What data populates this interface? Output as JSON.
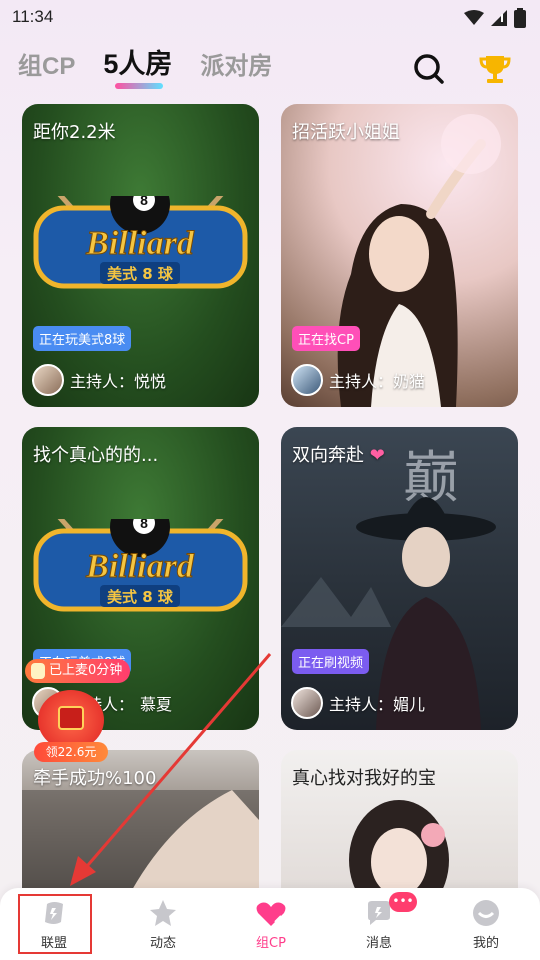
{
  "status": {
    "time": "11:34"
  },
  "tabs": [
    {
      "label": "组CP"
    },
    {
      "label": "5人房"
    },
    {
      "label": "派对房"
    }
  ],
  "cards": [
    {
      "title": "距你2.2米",
      "tag": "正在玩美式8球",
      "host": "主持人：悦悦",
      "logo_text": "Billiard",
      "logo_sub": "美式 8 球"
    },
    {
      "title": "招活跃小姐姐",
      "tag": "正在找CP",
      "host": "主持人：奶猫"
    },
    {
      "title": "找个真心的的...",
      "tag": "正在玩美式8球",
      "host": "主持人：",
      "host_name": "慕夏",
      "logo_text": "Billiard",
      "logo_sub": "美式 8 球"
    },
    {
      "title": "双向奔赴",
      "tag": "正在刷视频",
      "host": "主持人：媚儿",
      "overlay_text": "巅"
    },
    {
      "title": "牵手成功%100"
    },
    {
      "title": "真心找对我好的宝"
    }
  ],
  "floating": {
    "mic_badge": "已上麦0分钟",
    "redpacket": "领22.6元"
  },
  "nav": [
    {
      "label": "联盟"
    },
    {
      "label": "动态"
    },
    {
      "label": "组CP"
    },
    {
      "label": "消息",
      "badge": "•••"
    },
    {
      "label": "我的"
    }
  ],
  "colors": {
    "accent": "#ff3d8b",
    "tag_blue": "#4a8cf2",
    "tag_pink": "#ff4fb8",
    "tag_purple": "#7b5cf0",
    "annotation_red": "#e53935"
  }
}
